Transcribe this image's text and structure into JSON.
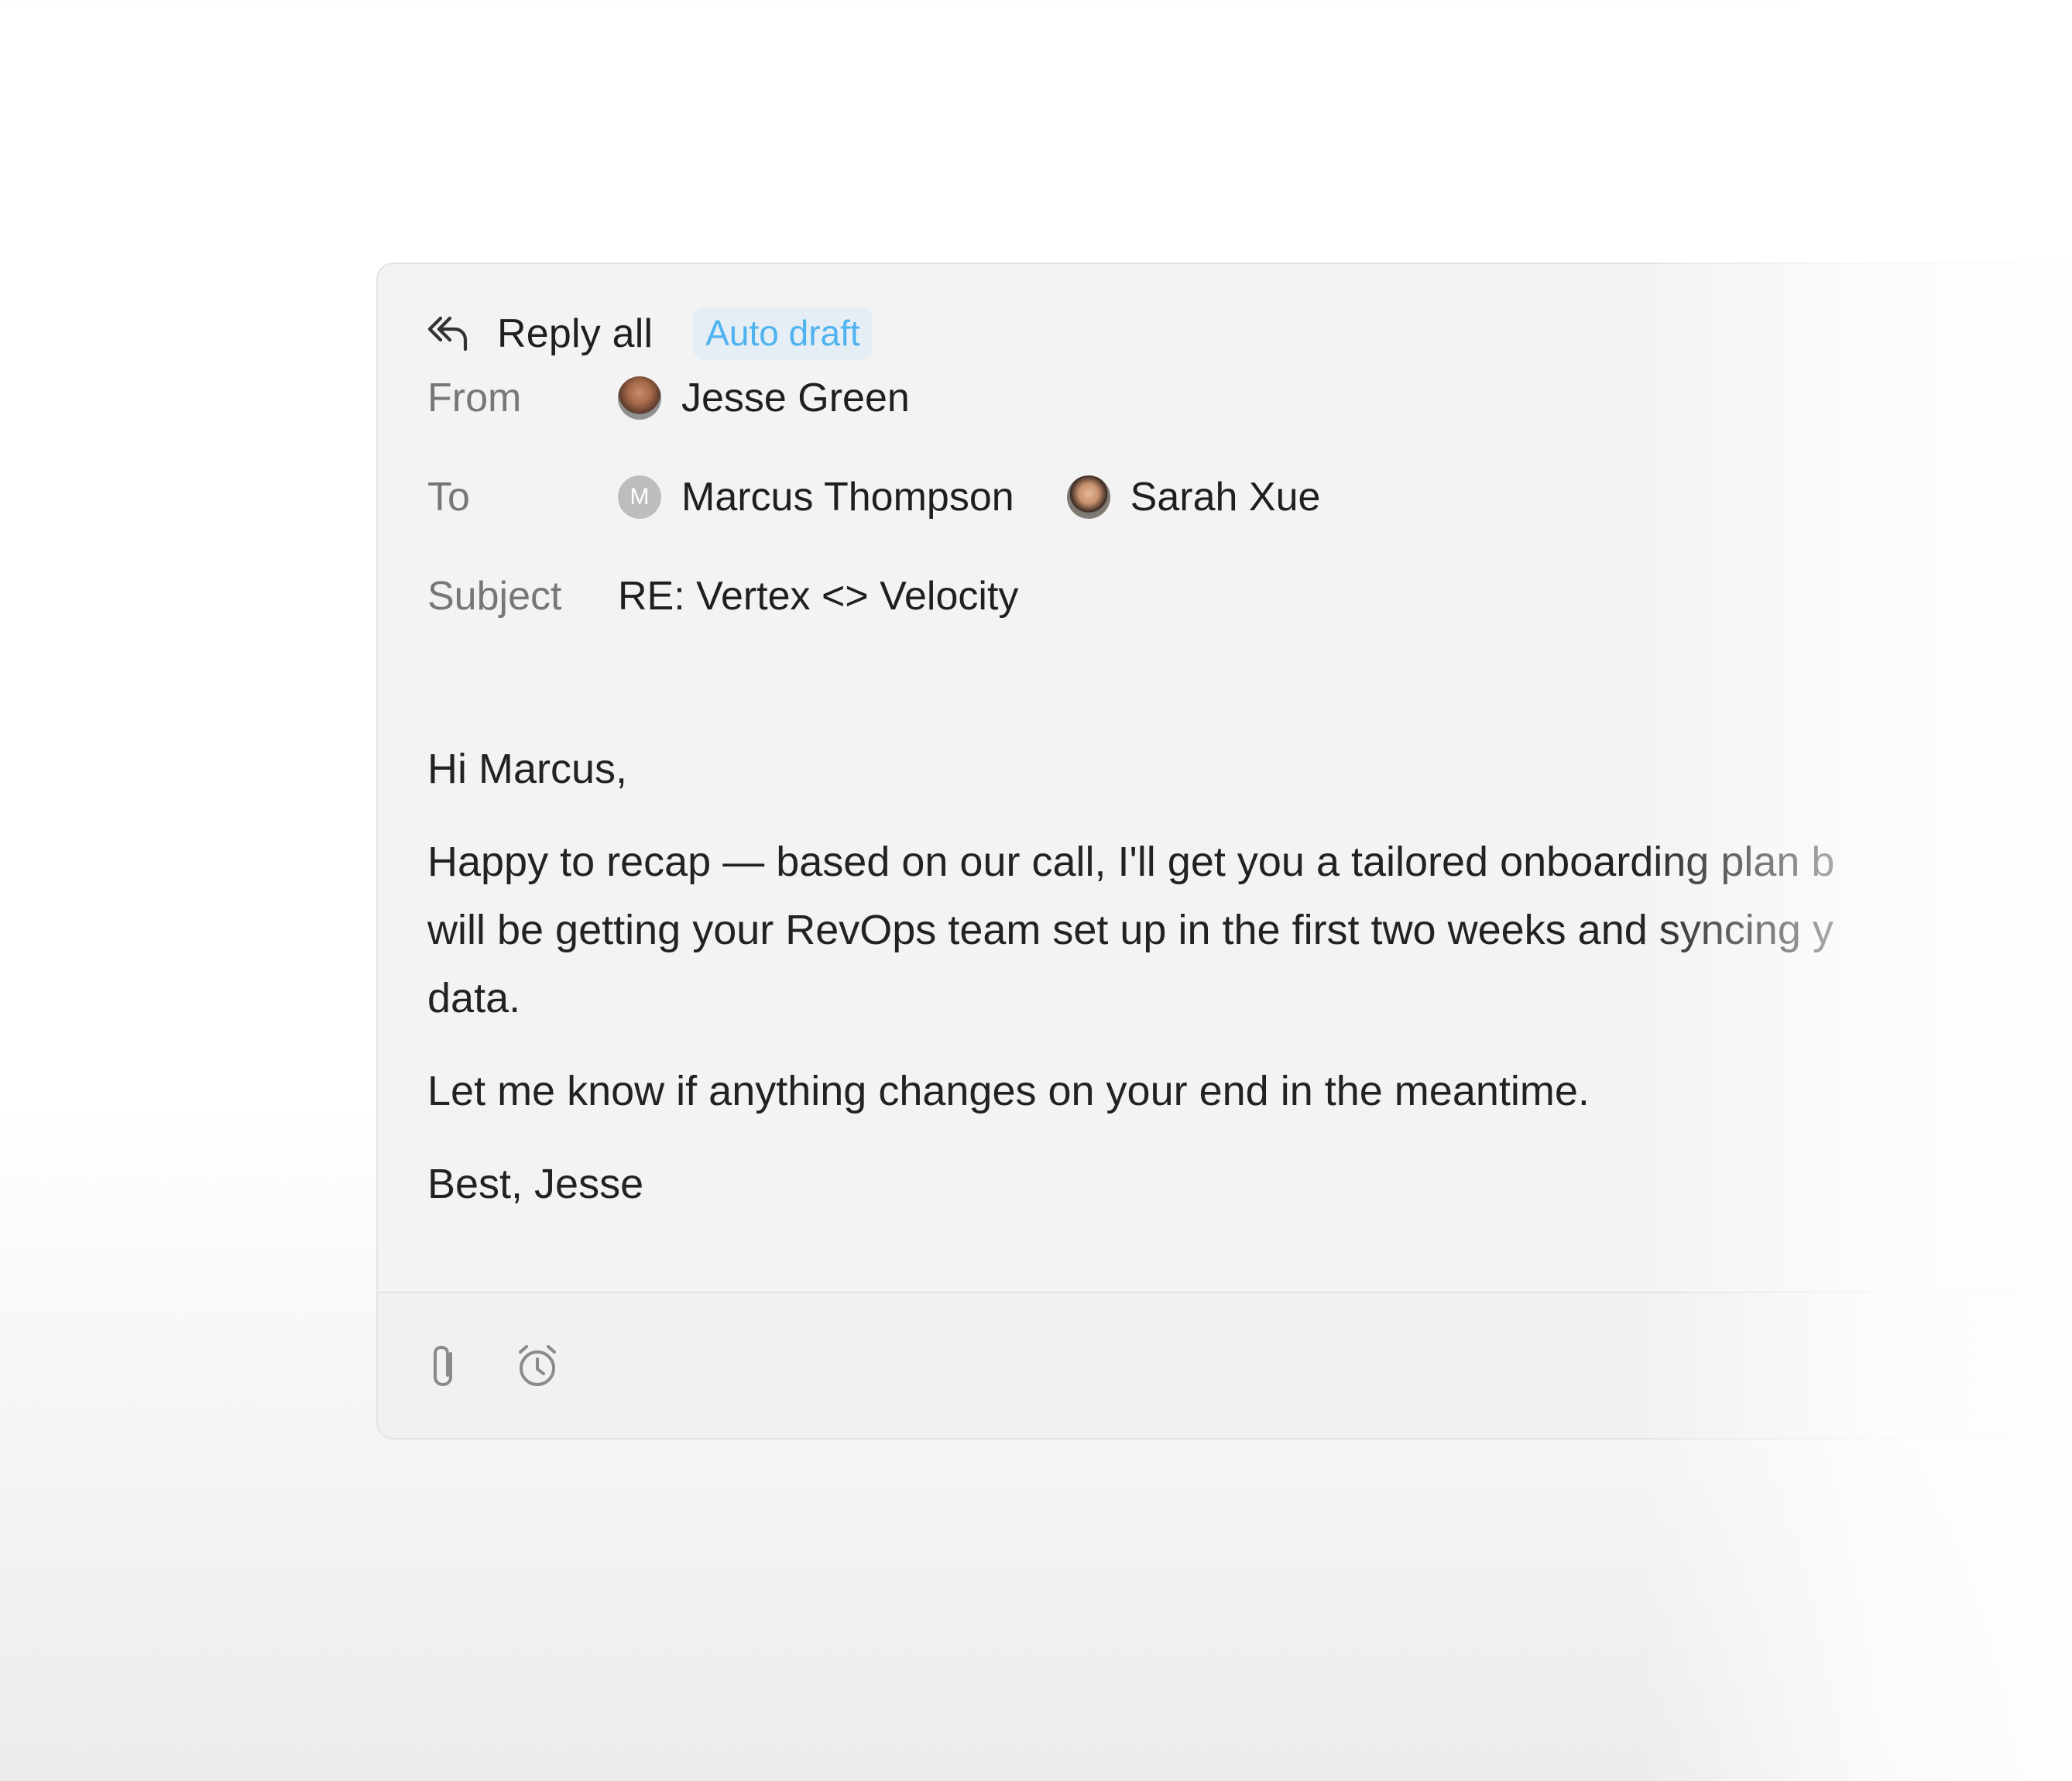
{
  "composer": {
    "mode_label": "Reply all",
    "badge": "Auto draft",
    "icons": {
      "reply_all": "reply-all-icon",
      "attach": "paperclip-icon",
      "schedule": "alarm-clock-icon"
    },
    "colors": {
      "badge_text": "#4fb3f0",
      "badge_bg": "#e6eef5",
      "panel_bg": "#f3f3f3"
    }
  },
  "fields": {
    "from": {
      "label": "From",
      "name": "Jesse Green"
    },
    "to": {
      "label": "To",
      "recipients": [
        {
          "name": "Marcus Thompson",
          "initial": "M"
        },
        {
          "name": "Sarah Xue"
        }
      ]
    },
    "subject": {
      "label": "Subject",
      "value": "RE: Vertex <> Velocity"
    }
  },
  "message": {
    "greeting": "Hi Marcus,",
    "paragraph1_line1": "Happy to recap — based on our call, I'll get you a tailored onboarding plan b",
    "paragraph1_line2": "will be getting your RevOps team set up in the first two weeks and syncing y",
    "paragraph1_line3": "data.",
    "paragraph2": "Let me know if anything changes on your end in the meantime.",
    "signoff": "Best, Jesse"
  }
}
